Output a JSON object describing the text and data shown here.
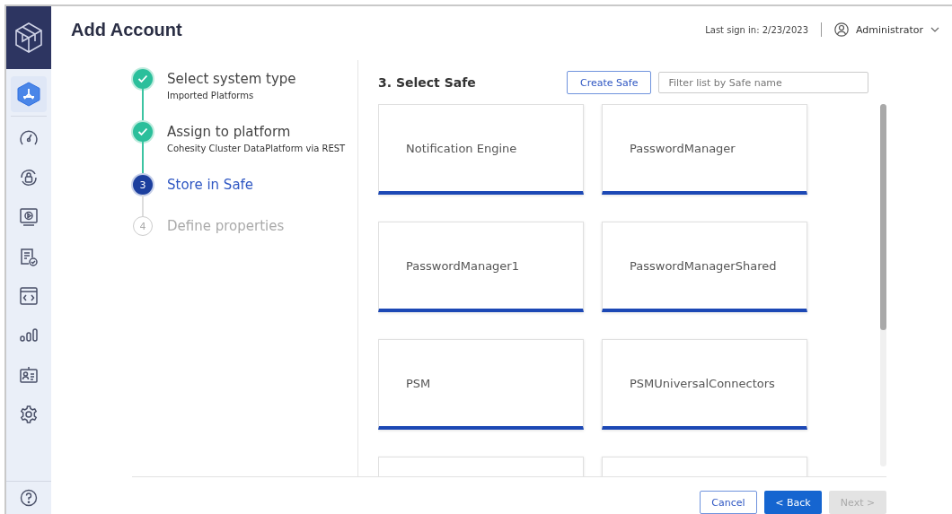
{
  "sidebar": {
    "items": [
      {
        "selected": true
      },
      {
        "selected": false
      },
      {
        "selected": false
      },
      {
        "selected": false
      },
      {
        "selected": false
      },
      {
        "selected": false
      },
      {
        "selected": false
      },
      {
        "selected": false
      },
      {
        "selected": false
      }
    ]
  },
  "header": {
    "title": "Add Account",
    "last_sign_in": "Last sign in: 2/23/2023",
    "user": "Administrator"
  },
  "steps": [
    {
      "title": "Select system type",
      "subtitle": "Imported Platforms",
      "completed": true,
      "selected": false
    },
    {
      "title": "Assign to platform",
      "subtitle": "Cohesity Cluster DataPlatform via REST",
      "completed": true,
      "selected": false
    },
    {
      "number": "3",
      "title": "Store in Safe",
      "completed": false,
      "selected": true
    },
    {
      "number": "4",
      "title": "Define properties",
      "completed": false,
      "selected": false
    }
  ],
  "panel": {
    "heading": "3. Select Safe",
    "create_button": "Create Safe",
    "filter": {
      "placeholder": "Filter list by Safe name"
    }
  },
  "safes": [
    {
      "kind": "safe",
      "name": "Notification Engine"
    },
    {
      "kind": "safe",
      "name": "PasswordManager"
    },
    {
      "kind": "safe",
      "name": "PasswordManager1"
    },
    {
      "kind": "safe",
      "name": "PasswordManagerShared"
    },
    {
      "kind": "safe",
      "name": "PSM"
    },
    {
      "kind": "safe",
      "name": "PSMUniversalConnectors"
    },
    {
      "kind": "cut"
    },
    {
      "kind": "cut"
    }
  ],
  "footer": {
    "cancel": "Cancel",
    "back": "< Back",
    "next": {
      "label": "Next >",
      "disabled": true
    }
  }
}
